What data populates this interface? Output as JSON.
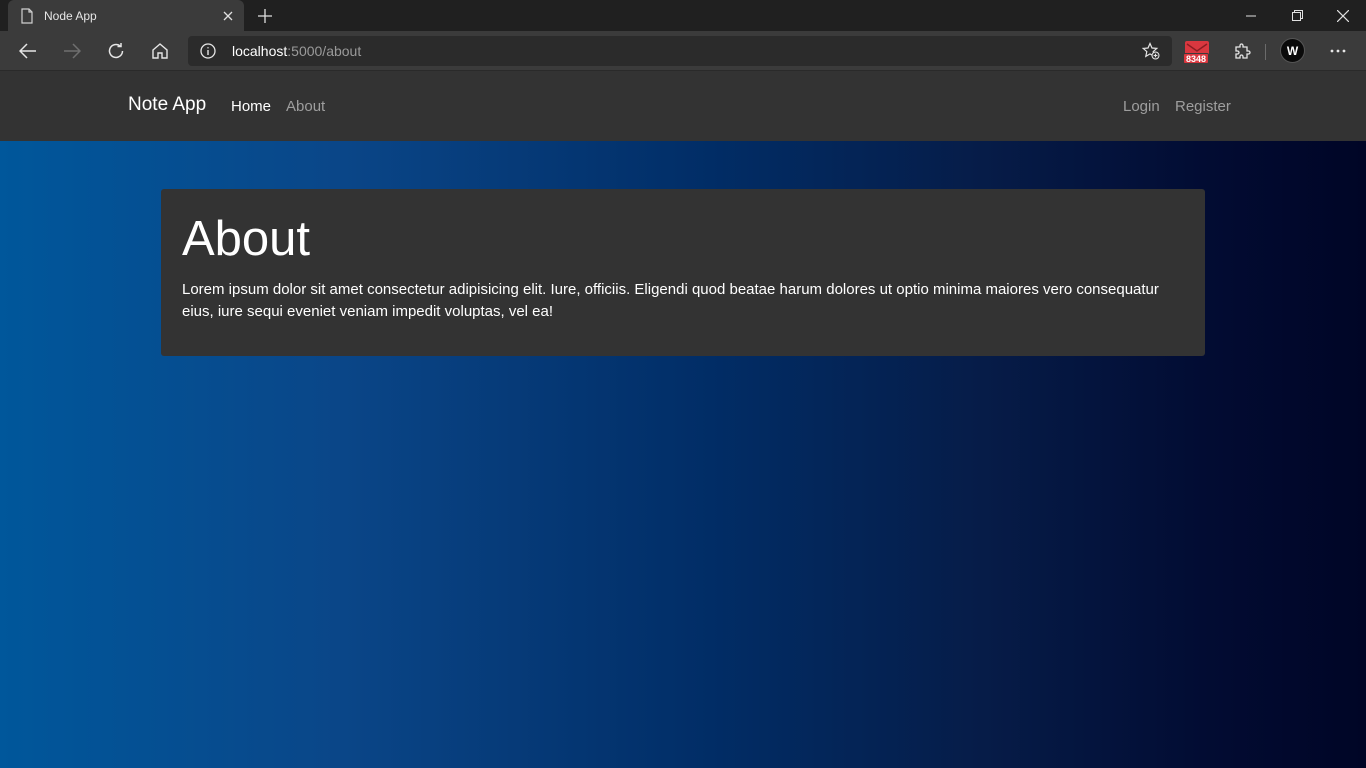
{
  "browser": {
    "tab_title": "Node App",
    "url_host": "localhost",
    "url_rest": ":5000/about",
    "mail_count": "8348",
    "profile_initial": "W"
  },
  "navbar": {
    "brand": "Note App",
    "links": [
      {
        "label": "Home",
        "active": true
      },
      {
        "label": "About",
        "active": false
      }
    ],
    "auth_links": [
      {
        "label": "Login"
      },
      {
        "label": "Register"
      }
    ]
  },
  "content": {
    "title": "About",
    "body": "Lorem ipsum dolor sit amet consectetur adipisicing elit. Iure, officiis. Eligendi quod beatae harum dolores ut optio minima maiores vero consequatur eius, iure sequi eveniet veniam impedit voluptas, vel ea!"
  },
  "colors": {
    "navbar_bg": "#333333",
    "card_bg": "#333333",
    "gradient_start": "#00579b",
    "gradient_end": "#000526",
    "mail_badge": "#d9373f"
  }
}
